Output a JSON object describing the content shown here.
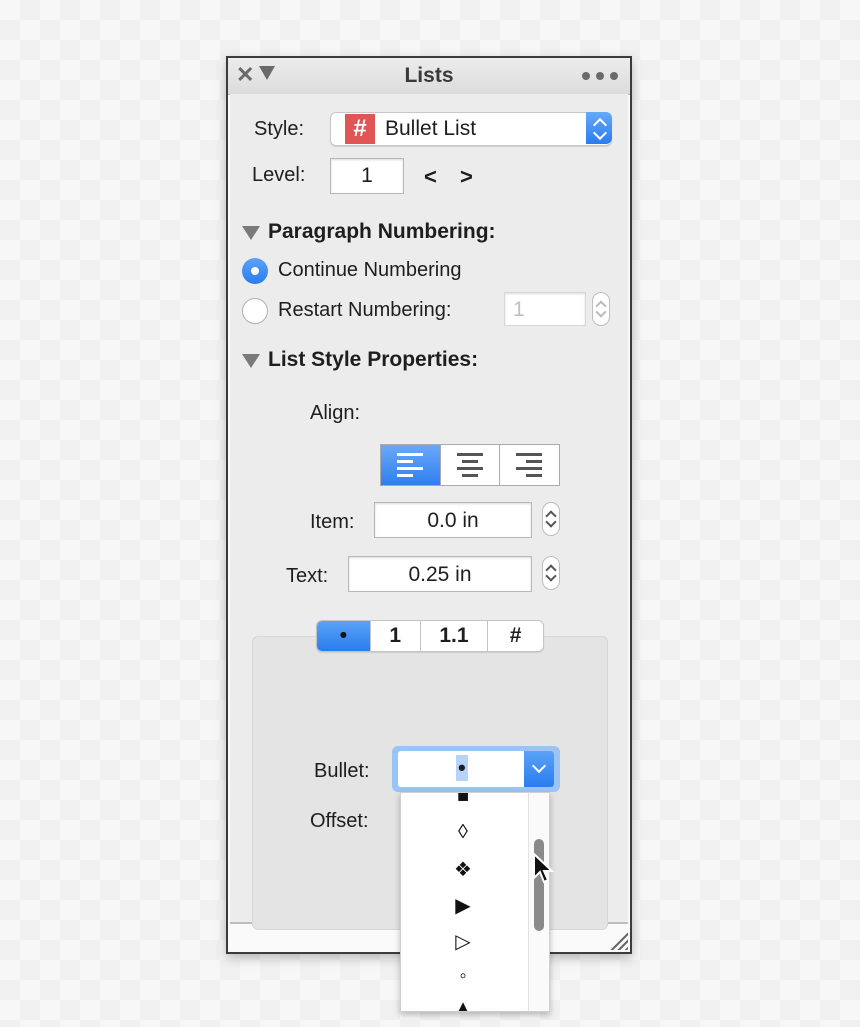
{
  "window": {
    "title": "Lists"
  },
  "style": {
    "label": "Style:",
    "value": "Bullet List"
  },
  "level": {
    "label": "Level:",
    "value": "1",
    "prev": "<",
    "next": ">"
  },
  "paragraph_numbering": {
    "title": "Paragraph Numbering:",
    "continue_label": "Continue Numbering",
    "restart_label": "Restart Numbering:",
    "restart_value": "1",
    "selected": "continue"
  },
  "list_style": {
    "title": "List Style Properties:",
    "align_label": "Align:",
    "align_selected": "left",
    "item_label": "Item:",
    "item_value": "0.0 in",
    "text_label": "Text:",
    "text_value": "0.25 in"
  },
  "tabs": [
    "•",
    "1",
    "1.1",
    "#"
  ],
  "active_tab": 0,
  "bullet": {
    "label": "Bullet:",
    "value": "•",
    "offset_label": "Offset:",
    "options": [
      "■",
      "◊",
      "❖",
      "▶",
      "▷",
      "◦",
      "▲"
    ]
  },
  "colors": {
    "accent": "#2a7cf0",
    "style_icon": "#e05555"
  }
}
